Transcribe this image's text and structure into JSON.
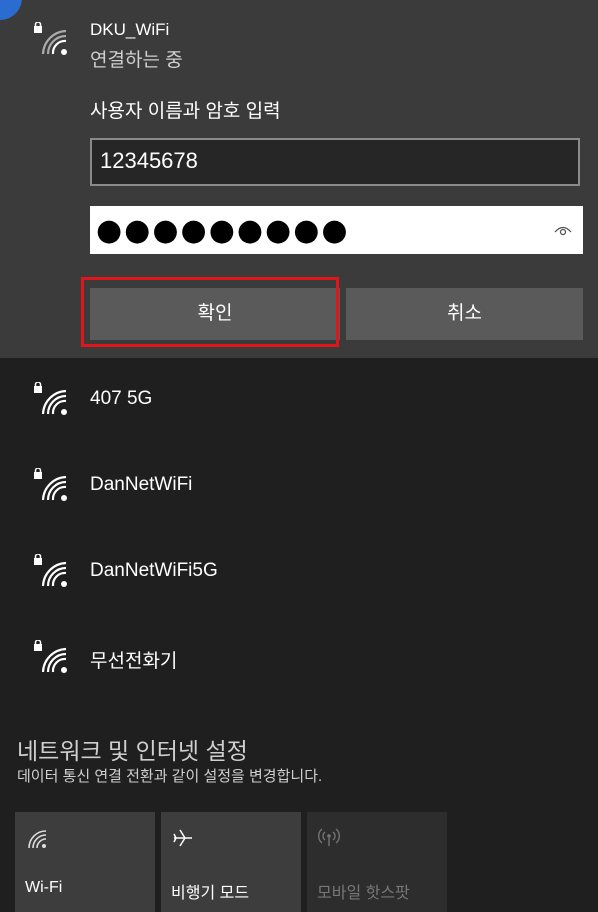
{
  "connecting": {
    "ssid": "DKU_WiFi",
    "status": "연결하는 중",
    "prompt": "사용자 이름과 암호 입력",
    "username_value": "12345678",
    "password_mask": "●●●●●●●●●",
    "ok_label": "확인",
    "cancel_label": "취소"
  },
  "networks": [
    {
      "name": "407 5G"
    },
    {
      "name": "DanNetWiFi"
    },
    {
      "name": "DanNetWiFi5G"
    },
    {
      "name": "무선전화기"
    }
  ],
  "settings": {
    "title": "네트워크 및 인터넷 설정",
    "subtitle": "데이터 통신 연결 전환과 같이 설정을 변경합니다."
  },
  "quick_actions": [
    {
      "label": "Wi-Fi",
      "icon": "wifi-icon",
      "enabled": true
    },
    {
      "label": "비행기 모드",
      "icon": "airplane-icon",
      "enabled": true
    },
    {
      "label": "모바일 핫스팟",
      "icon": "hotspot-icon",
      "enabled": false
    }
  ],
  "colors": {
    "highlight": "#e0161b",
    "panel_bg": "#3b3b3b",
    "list_bg": "#1f1f1f"
  }
}
